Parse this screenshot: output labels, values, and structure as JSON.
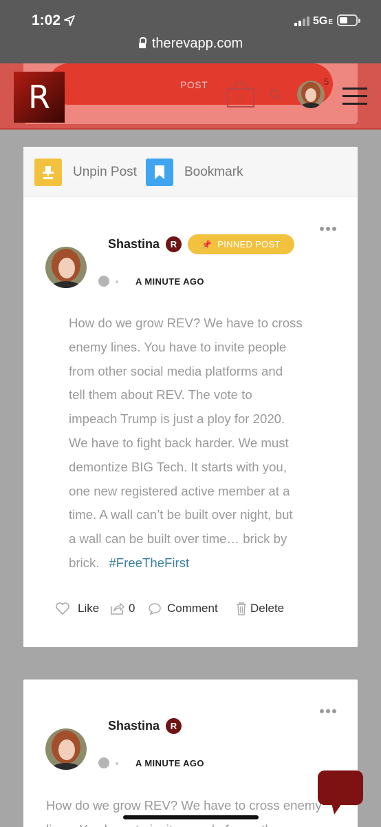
{
  "status_bar": {
    "time": "1:02",
    "network": "5G",
    "network_suffix": "E"
  },
  "browser": {
    "url": "therevapp.com"
  },
  "header": {
    "logo_letter": "R",
    "post_label": "POST",
    "cart_count": "0",
    "notification_count": "5",
    "icons": [
      "cart-icon",
      "search-icon",
      "avatar",
      "hamburger-menu-icon"
    ],
    "accent_color": "#e23a2d"
  },
  "posts": [
    {
      "actions": {
        "unpin_label": "Unpin Post",
        "bookmark_label": "Bookmark"
      },
      "author": "Shastina",
      "badge": "R",
      "pinned_label": "PINNED POST",
      "timestamp": "A MINUTE AGO",
      "lines": [
        "How do we grow REV? We have to cross",
        "enemy lines. You have to invite people",
        "from other social media platforms and",
        "tell them about REV. The vote to",
        "impeach Trump is just a ploy for 2020.",
        "We have to fight back harder. We must",
        "demontize BIG Tech. It starts with you,",
        "one new registered active member at a",
        "time. A wall can’t be built over night, but",
        "a wall can be built over time… brick by",
        "brick."
      ],
      "hashtag": "#FreeTheFirst",
      "footer": {
        "like": "Like",
        "share_count": "0",
        "comment": "Comment",
        "delete": "Delete"
      }
    },
    {
      "author": "Shastina",
      "badge": "R",
      "timestamp": "A MINUTE AGO",
      "lines": [
        "How do we grow REV? We have to cross enemy",
        "lines. You have to invite people from other"
      ]
    }
  ]
}
